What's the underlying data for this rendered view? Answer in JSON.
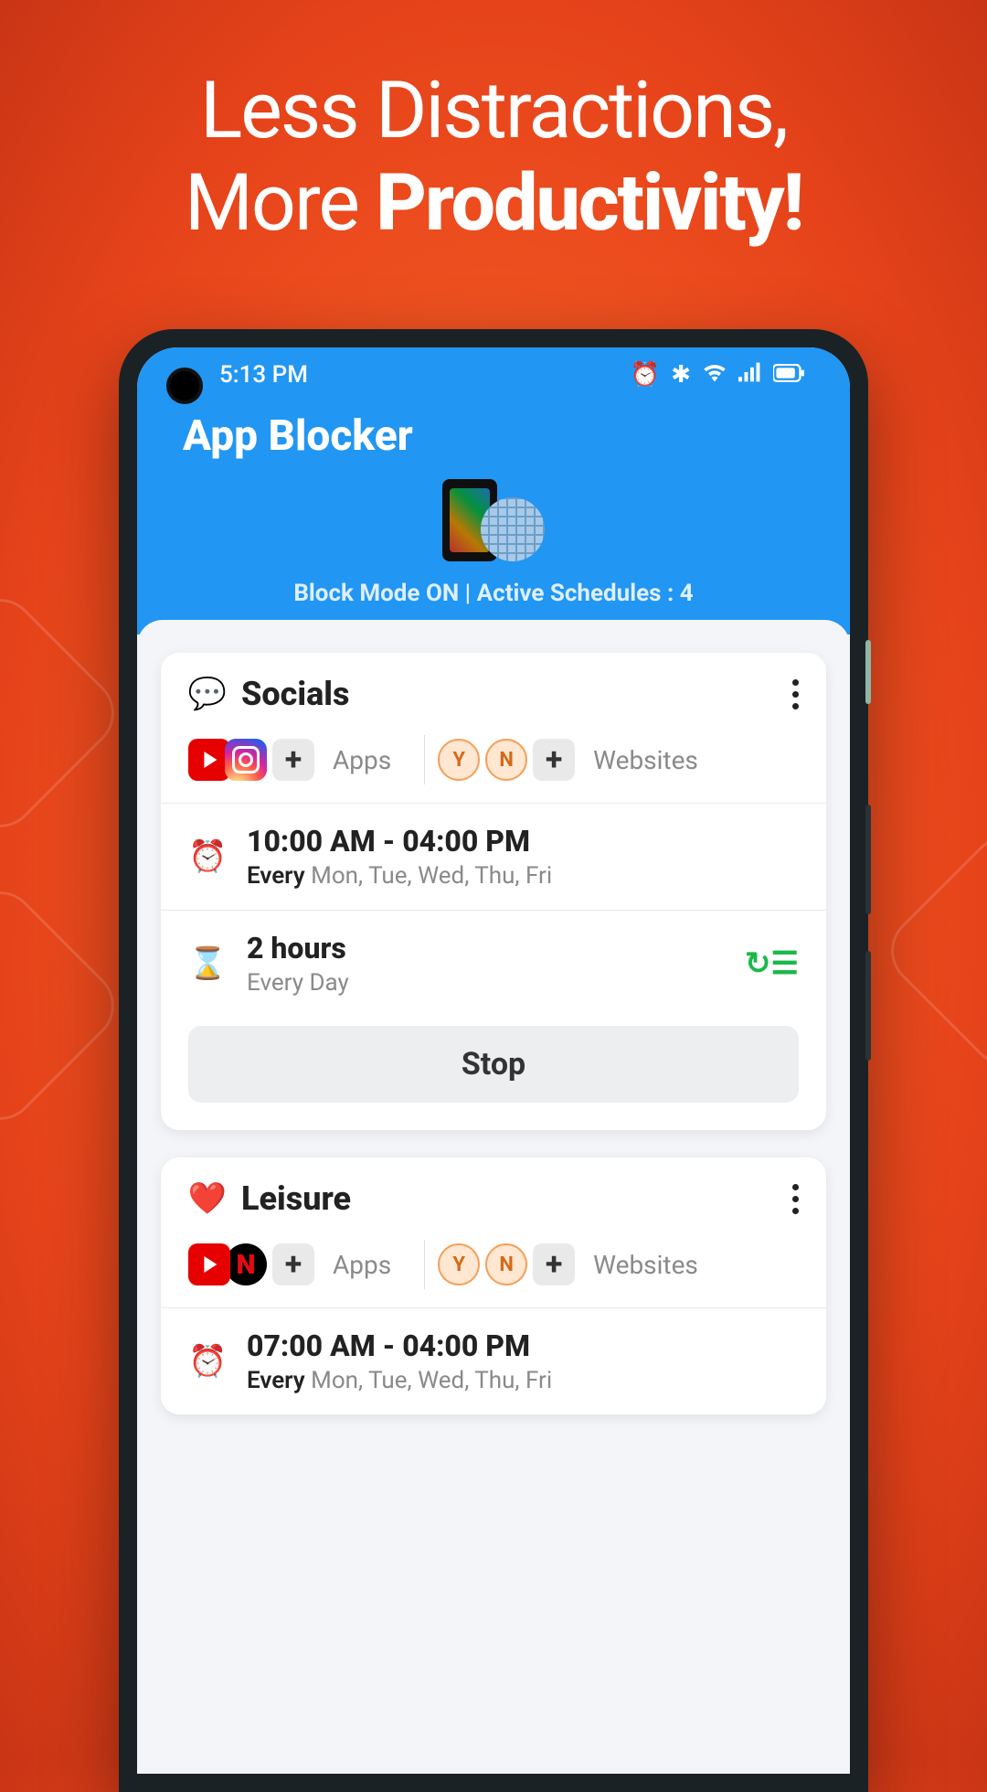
{
  "hero": {
    "line1": "Less Distractions,",
    "line2_prefix": "More ",
    "line2_bold": "Productivity!"
  },
  "statusbar": {
    "time": "5:13 PM"
  },
  "header": {
    "title": "App Blocker",
    "status": "Block Mode ON | Active Schedules : 4"
  },
  "labels": {
    "apps": "Apps",
    "websites": "Websites",
    "every": "Every",
    "stop": "Stop"
  },
  "cards": [
    {
      "icon": "chat",
      "title": "Socials",
      "apps": [
        "youtube",
        "instagram"
      ],
      "sites": [
        "Y",
        "N"
      ],
      "schedule_time": "10:00 AM - 04:00 PM",
      "schedule_days": "Mon, Tue, Wed, Thu, Fri",
      "limit": "2 hours",
      "limit_freq": "Every Day",
      "has_stop": true
    },
    {
      "icon": "heart",
      "title": "Leisure",
      "apps": [
        "youtube",
        "netflix"
      ],
      "sites": [
        "Y",
        "N"
      ],
      "schedule_time": "07:00 AM - 04:00 PM",
      "schedule_days": "Mon, Tue, Wed, Thu, Fri"
    }
  ]
}
